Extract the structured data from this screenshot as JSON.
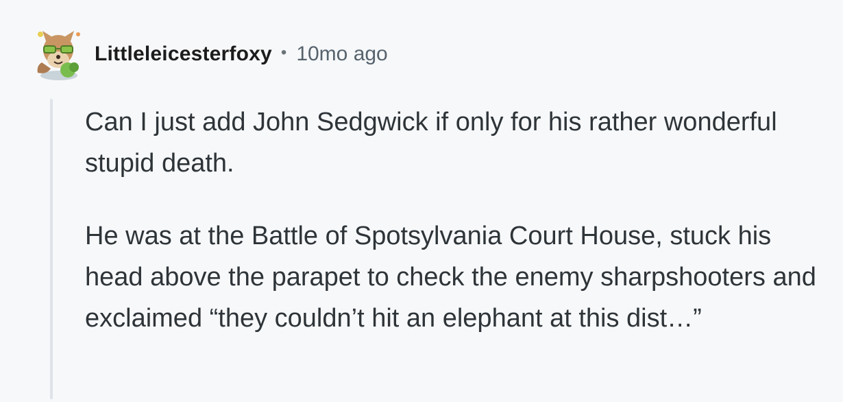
{
  "comment": {
    "author": "Littleleicesterfoxy",
    "separator": "•",
    "timestamp": "10mo ago",
    "avatar_icon": "fox-snoo-avatar-icon",
    "paragraphs": [
      "Can I just add John Sedgwick if only for his rather wonderful stupid death.",
      "He was at the Battle of Spotsylvania Court House, stuck his head above the parapet to check the enemy sharpshooters and exclaimed “they couldn’t hit an elephant at this dist…”"
    ]
  },
  "colors": {
    "background": "#f7f8fa",
    "thread_line": "#dfe4e8",
    "username": "#1c1c1c",
    "timestamp": "#56636d",
    "body_text": "#2e3438"
  }
}
